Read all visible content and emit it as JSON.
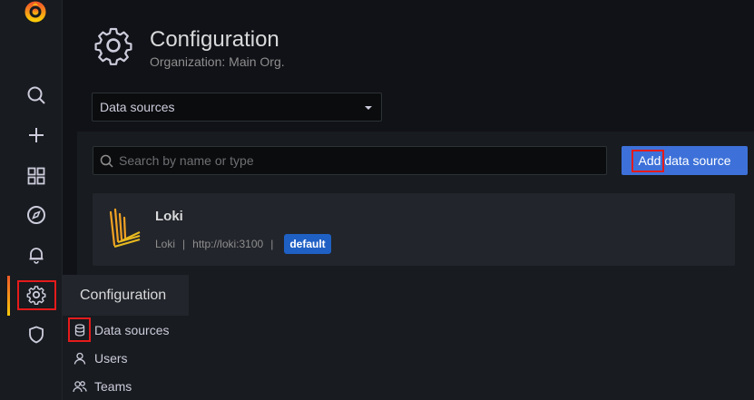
{
  "header": {
    "title": "Configuration",
    "subtitle": "Organization: Main Org."
  },
  "section_select": {
    "value": "Data sources"
  },
  "search": {
    "placeholder": "Search by name or type"
  },
  "add_button": {
    "label": "Add data source"
  },
  "datasources": [
    {
      "name": "Loki",
      "type": "Loki",
      "url": "http://loki:3100",
      "badge": "default"
    }
  ],
  "flyout": {
    "title": "Configuration",
    "items": [
      {
        "label": "Data sources",
        "icon": "database-icon"
      },
      {
        "label": "Users",
        "icon": "user-icon"
      },
      {
        "label": "Teams",
        "icon": "users-icon"
      }
    ]
  },
  "sidebar": {
    "items": [
      {
        "icon": "search-icon"
      },
      {
        "icon": "plus-icon"
      },
      {
        "icon": "dashboards-icon"
      },
      {
        "icon": "explore-icon"
      },
      {
        "icon": "bell-icon"
      },
      {
        "icon": "gear-icon"
      },
      {
        "icon": "shield-icon"
      }
    ]
  },
  "colors": {
    "accent": "#3d71d9",
    "highlight": "#e51b1b",
    "badge": "#1f60c4"
  }
}
